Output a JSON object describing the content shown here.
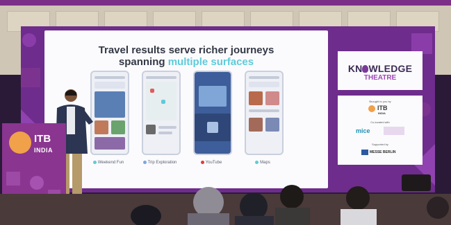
{
  "scene": {
    "description_free": true,
    "accent_color": "#6e2c8c",
    "slide_title_line1": "Travel results serve richer journeys",
    "slide_title_line2_plain": "spanning ",
    "slide_title_line2_accent": "multiple surfaces",
    "phones": [
      {
        "caption": "Weekend Fun",
        "icon": "compass-icon",
        "dot_color": "#5ecbd9"
      },
      {
        "caption": "Trip Exploration",
        "icon": "map-icon",
        "dot_color": "#7aa7e0"
      },
      {
        "caption": "YouTube",
        "icon": "youtube-icon",
        "dot_color": "#e23b3b"
      },
      {
        "caption": "Maps",
        "icon": "maps-icon",
        "dot_color": "#5ecbd9"
      }
    ],
    "knowledge_title_a": "KN",
    "knowledge_title_b": "WLEDGE",
    "knowledge_subtitle": "THEATRE",
    "partner_brought_by": "Brought to you by",
    "partner_itb": "ITB",
    "partner_itb_sub": "INDIA",
    "partner_collocated": "Co-located with",
    "partner_mice": "mice",
    "partner_supported": "Supported by",
    "partner_messe": "MESSE BERLIN",
    "podium_itb": "ITB",
    "podium_india": "INDIA"
  }
}
